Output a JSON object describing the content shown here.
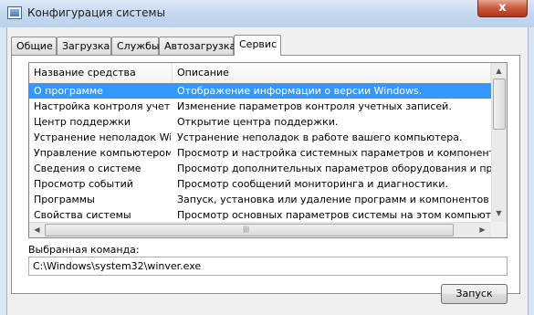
{
  "window": {
    "title": "Конфигурация системы",
    "close_label": "x"
  },
  "tabs": [
    {
      "label": "Общие"
    },
    {
      "label": "Загрузка"
    },
    {
      "label": "Службы"
    },
    {
      "label": "Автозагрузка"
    },
    {
      "label": "Сервис",
      "active": true
    }
  ],
  "list": {
    "headers": [
      "Название средства",
      "Описание"
    ],
    "rows": [
      {
        "name": "О программе",
        "desc": "Отображение информации о версии Windows.",
        "selected": true
      },
      {
        "name": "Настройка контроля учетн...",
        "desc": "Изменение параметров контроля учетных записей."
      },
      {
        "name": "Центр поддержки",
        "desc": "Открытие центра поддержки."
      },
      {
        "name": "Устранение неполадок Win...",
        "desc": "Устранение неполадок в работе вашего компьютера."
      },
      {
        "name": "Управление компьютером",
        "desc": "Просмотр и настройка системных параметров и компонентов."
      },
      {
        "name": "Сведения о системе",
        "desc": "Просмотр дополнительных параметров оборудования и программного"
      },
      {
        "name": "Просмотр событий",
        "desc": "Просмотр сообщений мониторинга и диагностики."
      },
      {
        "name": "Программы",
        "desc": "Запуск, установка или удаление программ и компонентов Windows."
      },
      {
        "name": "Свойства системы",
        "desc": "Просмотр основных параметров системы на этом компьютере."
      }
    ]
  },
  "command": {
    "label": "Выбранная команда:",
    "value": "C:\\Windows\\system32\\winver.exe"
  },
  "run_button": {
    "label": "Запуск"
  }
}
